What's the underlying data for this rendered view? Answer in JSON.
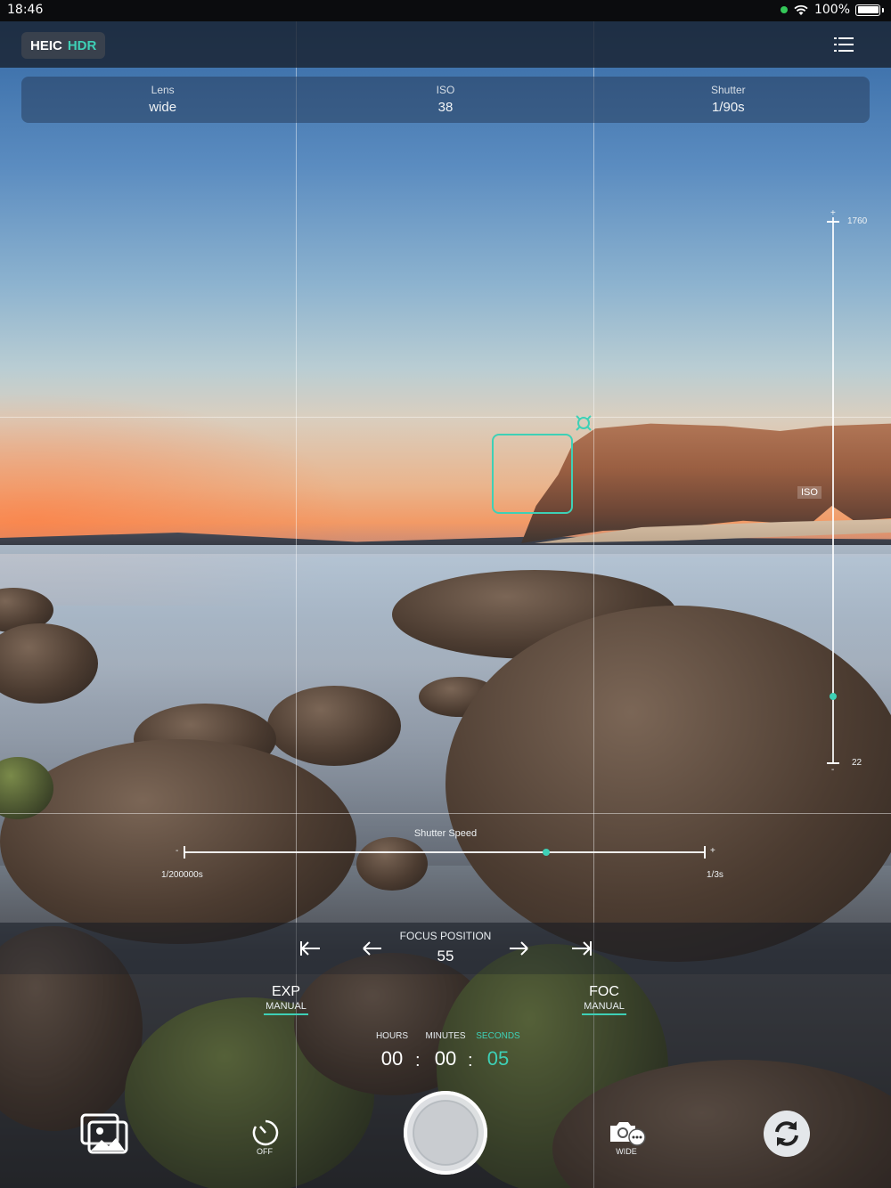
{
  "status_bar": {
    "time": "18:46",
    "battery": "100%"
  },
  "toolbar": {
    "format": "HEIC",
    "hdr": "HDR",
    "menu_icon": "list-menu-icon"
  },
  "info": {
    "lens_label": "Lens",
    "lens_value": "wide",
    "iso_label": "ISO",
    "iso_value": "38",
    "shutter_label": "Shutter",
    "shutter_value": "1/90s"
  },
  "iso_slider": {
    "plus": "+",
    "minus": "-",
    "max": "1760",
    "min": "22",
    "label": "ISO",
    "value": 38,
    "range": [
      22,
      1760
    ]
  },
  "shutter_slider": {
    "title": "Shutter Speed",
    "minus": "-",
    "plus": "+",
    "min_label": "1/200000s",
    "max_label": "1/3s",
    "position_fraction": 0.69
  },
  "focus": {
    "title": "FOCUS POSITION",
    "value": "55"
  },
  "modes": {
    "exp_label": "EXP",
    "exp_sub": "MANUAL",
    "foc_label": "FOC",
    "foc_sub": "MANUAL"
  },
  "timer": {
    "hours_label": "HOURS",
    "minutes_label": "MINUTES",
    "seconds_label": "SECONDS",
    "hours": "00",
    "minutes": "00",
    "seconds": "05",
    "sep": ":"
  },
  "bottom": {
    "timer_caption": "OFF",
    "camera_caption": "WIDE"
  },
  "colors": {
    "accent": "#3ed0b6"
  }
}
